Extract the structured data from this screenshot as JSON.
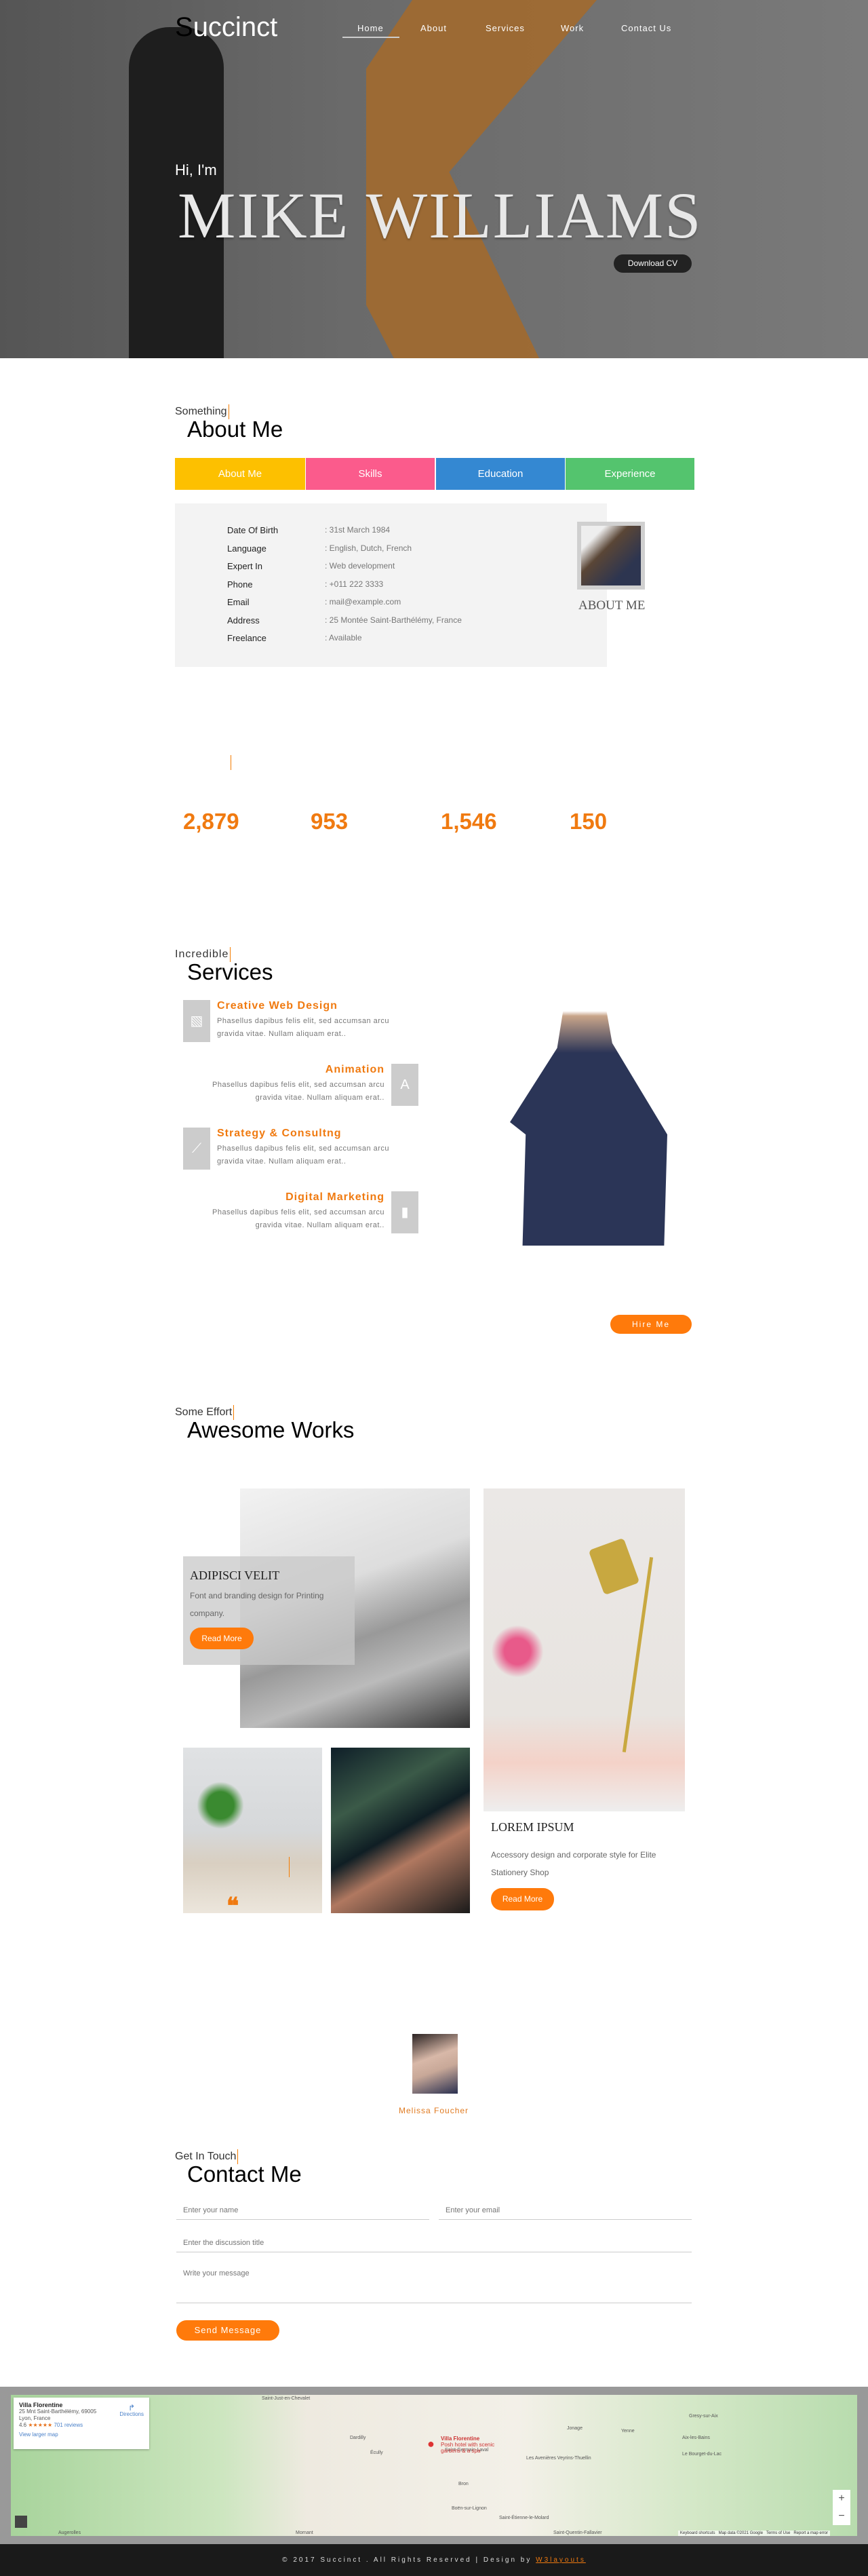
{
  "nav": {
    "logo_first": "S",
    "logo_rest": "uccinct",
    "items": [
      "Home",
      "About",
      "Services",
      "Work",
      "Contact Us"
    ]
  },
  "hero": {
    "greeting": "Hi, I'm",
    "name": "MIKE WILLIAMS",
    "download": "Download CV"
  },
  "about": {
    "sub": "Something",
    "title": "About Me",
    "tabs": [
      {
        "label": "About Me",
        "color": "#fdc000"
      },
      {
        "label": "Skills",
        "color": "#fb5b8c"
      },
      {
        "label": "Education",
        "color": "#3488d2"
      },
      {
        "label": "Experience",
        "color": "#54c46e"
      }
    ],
    "rows": [
      {
        "label": "Date Of Birth",
        "value": ": 31st March 1984"
      },
      {
        "label": "Language",
        "value": ": English, Dutch, French"
      },
      {
        "label": "Expert In",
        "value": ": Web development"
      },
      {
        "label": "Phone",
        "value": ": +011 222 3333"
      },
      {
        "label": "Email",
        "value": ": mail@example.com"
      },
      {
        "label": "Address",
        "value": ": 25 Montée Saint-Barthélémy, France"
      },
      {
        "label": "Freelance",
        "value": ": Available"
      }
    ],
    "photo_caption": "ABOUT ME"
  },
  "stats": [
    "2,879",
    "953",
    "1,546",
    "150"
  ],
  "services": {
    "sub": "Incredible",
    "title": "Services",
    "items": [
      {
        "title": "Creative Web Design",
        "desc1": "Phasellus dapibus felis elit, sed accumsan arcu",
        "desc2": "gravida vitae. Nullam aliquam erat..",
        "icon": "image-icon"
      },
      {
        "title": "Animation",
        "desc1": "Phasellus dapibus felis elit, sed accumsan arcu",
        "desc2": "gravida vitae. Nullam aliquam erat..",
        "icon": "font-icon"
      },
      {
        "title": "Strategy & Consultng",
        "desc1": "Phasellus dapibus felis elit, sed accumsan arcu",
        "desc2": "gravida vitae. Nullam aliquam erat..",
        "icon": "line-chart-icon"
      },
      {
        "title": "Digital Marketing",
        "desc1": "Phasellus dapibus felis elit, sed accumsan arcu",
        "desc2": "gravida vitae. Nullam aliquam erat..",
        "icon": "bar-chart-icon"
      }
    ],
    "hire": "Hire Me"
  },
  "works": {
    "sub": "Some Effort",
    "title": "Awesome Works",
    "item1": {
      "title": "ADIPISCI VELIT",
      "desc": "Font and branding design for Printing company.",
      "button": "Read More"
    },
    "item2": {
      "title": "LOREM IPSUM",
      "desc": "Accessory design and corporate style for Elite Stationery Shop",
      "button": "Read More"
    }
  },
  "testimonial": {
    "quote_icon": "❝",
    "name": "Melissa Foucher"
  },
  "contact": {
    "sub": "Get In Touch",
    "title": "Contact Me",
    "name_ph": "Enter your name",
    "email_ph": "Enter your email",
    "title_ph": "Enter the discussion title",
    "message_ph": "Write your message",
    "send": "Send Message"
  },
  "map": {
    "place": "Villa Florentine",
    "address1": "25 Mnt Saint-Barthélémy, 69005",
    "address2": "Lyon, France",
    "rating": "4.6",
    "stars": "★★★★★",
    "reviews": "701 reviews",
    "larger": "View larger map",
    "directions": "Directions",
    "pin_title": "Villa Florentine",
    "pin_desc1": "Posh hotel with scenic",
    "pin_desc2": "gardens & a spa",
    "towns": [
      "Saint-Just-en-Chevalet",
      "Saint-Germain-Laval",
      "Boën-sur-Lignon",
      "Saint-Étienne-le-Molard",
      "Augerolles",
      "Dardilly",
      "Écully",
      "Bron",
      "Jonage",
      "Mornant",
      "Saint-Quentin-Fallavier",
      "Villefontaine",
      "Yenne",
      "Aix-les-Bains",
      "Le Bourget-du-Lac",
      "Gresy-sur-Aix",
      "Les Avenières Veyrins-Thuellin"
    ],
    "attribution": [
      "Keyboard shortcuts",
      "Map data ©2021 Google",
      "Terms of Use",
      "Report a map error"
    ]
  },
  "footer": {
    "text": "© 2017 Succinct . All Rights Reserved | Design by ",
    "link": "W3layouts"
  }
}
